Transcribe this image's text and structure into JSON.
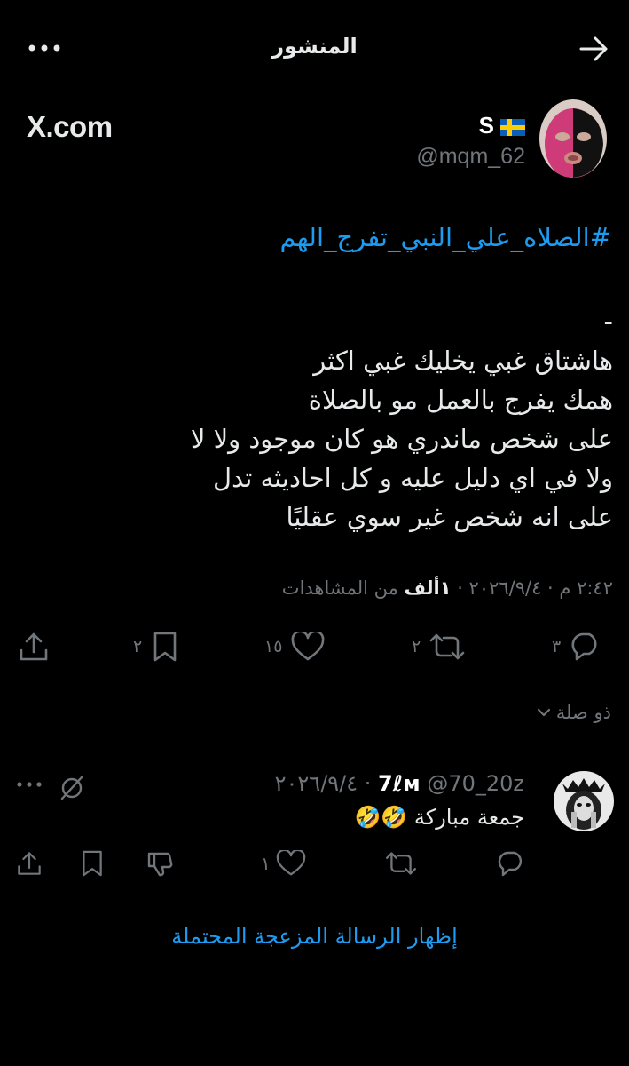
{
  "header": {
    "title": "المنشور"
  },
  "watermark": "X.com",
  "post": {
    "author_name": "S",
    "author_flag": "🇸🇪",
    "handle": "@mqm_62",
    "hashtag": "#الصلاه_علي_النبي_تفرج_الهم",
    "lines": [
      "-",
      "هاشتاق غبي يخليك غبي اكثر",
      "همك يفرج بالعمل مو بالصلاة",
      "على شخص ماندري هو كان موجود ولا لا",
      "ولا في اي دليل عليه و كل احاديثه تدل",
      "على انه شخص غير سوي عقليًا"
    ],
    "meta_time": "٢:٤٢ م · ٢٠٢٦/٩/٤ · ",
    "meta_views_count": "١ألف",
    "meta_views_label": " من المشاهدات",
    "counts": {
      "replies": "٣",
      "reposts": "٢",
      "likes": "١٥",
      "bookmarks": "٢"
    }
  },
  "related_label": "ذو صلة",
  "reply": {
    "name": "7ℓм",
    "handle": "@70_20z",
    "date": "٢٠٢٦/٩/٤",
    "separator": " · ",
    "text": "جمعة مباركة 🤣🤣",
    "likes": "١"
  },
  "show_spam_label": "إظهار الرسالة المزعجة المحتملة",
  "colors": {
    "background": "#000000",
    "text": "#e7e9ea",
    "muted": "#71767b",
    "link": "#1d9bf0",
    "divider": "#2f3336"
  }
}
